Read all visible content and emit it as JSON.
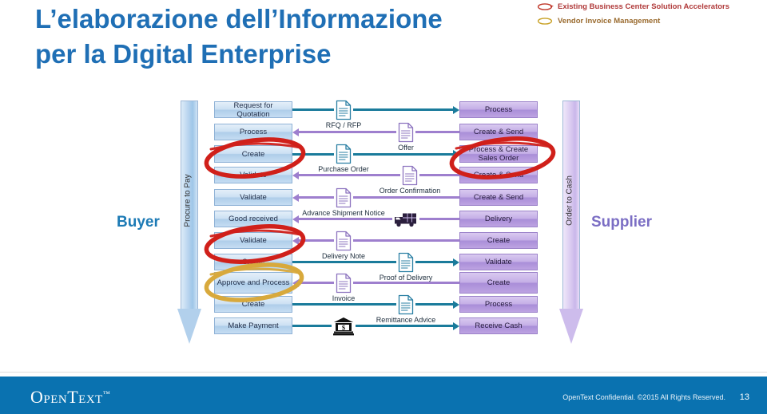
{
  "slide": {
    "title_line1": "L’elaborazione dell’Informazione",
    "title_line2": "per la Digital Enterprise",
    "title_color": "#1f6fb5"
  },
  "legend": {
    "items": [
      {
        "label": "Existing Business Center Solution Accelerators",
        "icon": "ellipse-outline-icon",
        "color": "#c0392b"
      },
      {
        "label": "Vendor Invoice Management",
        "icon": "ellipse-outline-icon",
        "color": "#c9a227"
      }
    ]
  },
  "roles": {
    "left": "Buyer",
    "right": "Supplier"
  },
  "bands": {
    "left": {
      "label": "Procure to Pay",
      "color": "#b2d0ec"
    },
    "right": {
      "label": "Order to Cash",
      "color": "#cdbcec"
    }
  },
  "buyer_steps": [
    {
      "label": "Request for Quotation"
    },
    {
      "label": "Process"
    },
    {
      "label": "Create"
    },
    {
      "label": "Validate"
    },
    {
      "label": "Validate"
    },
    {
      "label": "Good received"
    },
    {
      "label": "Validate"
    },
    {
      "label": "Create"
    },
    {
      "label": "Approve and Process"
    },
    {
      "label": "Create"
    },
    {
      "label": "Make Payment"
    }
  ],
  "supplier_steps": [
    {
      "label": "Process"
    },
    {
      "label": "Create & Send"
    },
    {
      "label": "Process & Create Sales Order"
    },
    {
      "label": "Create & Send"
    },
    {
      "label": "Create & Send"
    },
    {
      "label": "Delivery"
    },
    {
      "label": "Create"
    },
    {
      "label": "Validate"
    },
    {
      "label": "Create"
    },
    {
      "label": "Process"
    },
    {
      "label": "Receive Cash"
    }
  ],
  "documents": [
    {
      "label": "RFQ / RFP",
      "direction": "right",
      "icon": "document-icon"
    },
    {
      "label": "Offer",
      "direction": "left",
      "icon": "document-icon"
    },
    {
      "label": "Purchase Order",
      "direction": "right",
      "icon": "document-icon"
    },
    {
      "label": "Order Confirmation",
      "direction": "left",
      "icon": "document-icon"
    },
    {
      "label": "Advance Shipment Notice",
      "direction": "left",
      "icon": "document-icon"
    },
    {
      "label": "",
      "direction": "left",
      "icon": "truck-icon"
    },
    {
      "label": "Delivery Note",
      "direction": "left",
      "icon": "document-icon"
    },
    {
      "label": "Proof of Delivery",
      "direction": "right",
      "icon": "document-icon"
    },
    {
      "label": "Invoice",
      "direction": "left",
      "icon": "document-icon"
    },
    {
      "label": "Remittance Advice",
      "direction": "right",
      "icon": "document-icon"
    },
    {
      "label": "",
      "direction": "right",
      "icon": "bank-icon"
    }
  ],
  "highlights": [
    {
      "target": "buyer-step-3",
      "color": "#d0201a",
      "legend": "Existing Business Center Solution Accelerators"
    },
    {
      "target": "buyer-step-7",
      "color": "#d0201a",
      "legend": "Existing Business Center Solution Accelerators"
    },
    {
      "target": "buyer-step-9",
      "color": "#d8a93c",
      "legend": "Vendor Invoice Management"
    },
    {
      "target": "supplier-step-3",
      "color": "#d0201a",
      "legend": "Existing Business Center Solution Accelerators"
    }
  ],
  "footer": {
    "logo": "OpenText",
    "logo_tm": "™",
    "confidential": "OpenText Confidential. ©2015 All Rights Reserved.",
    "page_number": "13",
    "background": "#0a72b0"
  }
}
